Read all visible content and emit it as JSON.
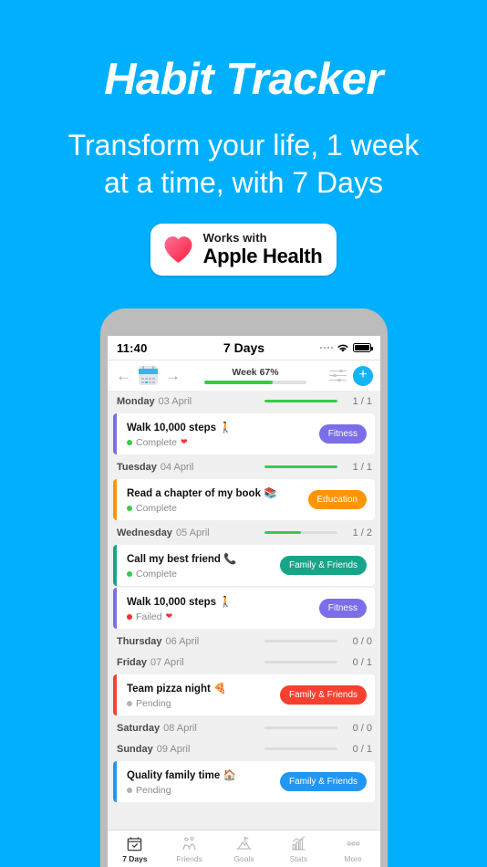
{
  "promo": {
    "title": "Habit Tracker",
    "subtitle_line1": "Transform your life, 1 week",
    "subtitle_line2": "at a time, with 7 Days",
    "background_color": "#00b0ff"
  },
  "health_badge": {
    "works_with": "Works with",
    "product": "Apple Health",
    "heart_icon": "heart-icon",
    "gradient_from": "#ff5f8f",
    "gradient_to": "#fb2c36"
  },
  "phone": {
    "statusbar": {
      "time": "11:40",
      "title": "7 Days",
      "signal_icon": "signal-dots-icon",
      "wifi_icon": "wifi-icon",
      "battery_icon": "battery-full-icon"
    },
    "toolbar": {
      "prev_icon": "arrow-left-icon",
      "calendar_icon": "calendar-icon",
      "next_icon": "arrow-right-icon",
      "week_label": "Week 67%",
      "week_percent": 67,
      "filter_icon": "sliders-icon",
      "add_label": "+",
      "accent_color": "#14b4f5",
      "progress_color": "#35cc4b"
    },
    "days": [
      {
        "name": "Monday",
        "date": "03 April",
        "count": "1 / 1",
        "percent": 100,
        "habits": [
          {
            "title": "Walk 10,000 steps 🚶",
            "status": "Complete",
            "status_type": "complete",
            "health_icon": "❤",
            "category": "Fitness",
            "color": "#7b6ee8"
          }
        ]
      },
      {
        "name": "Tuesday",
        "date": "04 April",
        "count": "1 / 1",
        "percent": 100,
        "habits": [
          {
            "title": "Read a chapter of my book 📚",
            "status": "Complete",
            "status_type": "complete",
            "health_icon": "",
            "category": "Education",
            "color": "#ff9500"
          }
        ]
      },
      {
        "name": "Wednesday",
        "date": "05 April",
        "count": "1 / 2",
        "percent": 50,
        "habits": [
          {
            "title": "Call my best friend 📞",
            "status": "Complete",
            "status_type": "complete",
            "health_icon": "",
            "category": "Family & Friends",
            "color": "#17a589"
          },
          {
            "title": "Walk 10,000 steps 🚶",
            "status": "Failed",
            "status_type": "failed",
            "health_icon": "❤",
            "category": "Fitness",
            "color": "#7b6ee8"
          }
        ]
      },
      {
        "name": "Thursday",
        "date": "06 April",
        "count": "0 / 0",
        "percent": 0,
        "habits": []
      },
      {
        "name": "Friday",
        "date": "07 April",
        "count": "0 / 1",
        "percent": 0,
        "habits": [
          {
            "title": "Team pizza night 🍕",
            "status": "Pending",
            "status_type": "pending",
            "health_icon": "",
            "category": "Family & Friends",
            "color": "#f8402f"
          }
        ]
      },
      {
        "name": "Saturday",
        "date": "08 April",
        "count": "0 / 0",
        "percent": 0,
        "habits": []
      },
      {
        "name": "Sunday",
        "date": "09 April",
        "count": "0 / 1",
        "percent": 0,
        "habits": [
          {
            "title": "Quality family time 🏠",
            "status": "Pending",
            "status_type": "pending",
            "health_icon": "",
            "category": "Family & Friends",
            "color": "#2196f3"
          }
        ]
      }
    ],
    "status_colors": {
      "complete": "#35cc4b",
      "failed": "#fb2c36",
      "pending": "#b4b4b4"
    },
    "tabs": [
      {
        "label": "7 Days",
        "icon": "calendar-check-icon",
        "active": true
      },
      {
        "label": "Friends",
        "icon": "friends-icon",
        "active": false
      },
      {
        "label": "Goals",
        "icon": "mountain-flag-icon",
        "active": false
      },
      {
        "label": "Stats",
        "icon": "bar-chart-icon",
        "active": false
      },
      {
        "label": "More",
        "icon": "ellipsis-icon",
        "active": false
      }
    ]
  }
}
